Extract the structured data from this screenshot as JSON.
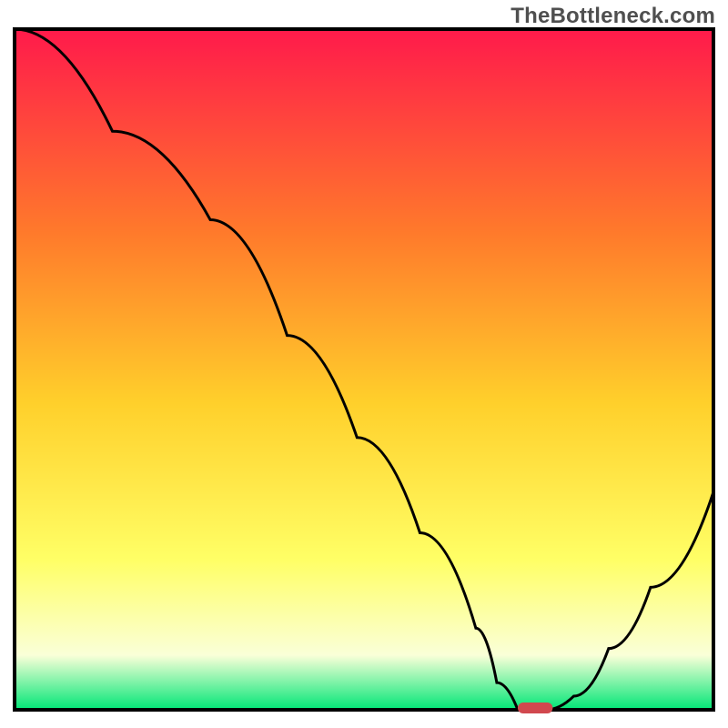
{
  "watermark": "TheBottleneck.com",
  "colors": {
    "border": "#000000",
    "curve": "#000000",
    "marker_fill": "#d1484e",
    "grad_top": "#ff1a4b",
    "grad_mid1": "#ff7a2b",
    "grad_mid2": "#ffd02b",
    "grad_mid3": "#ffff66",
    "grad_mid4": "#faffd8",
    "grad_bottom": "#00e676"
  },
  "chart_data": {
    "type": "line",
    "title": "",
    "xlabel": "",
    "ylabel": "",
    "xlim": [
      0,
      100
    ],
    "ylim": [
      0,
      100
    ],
    "x": [
      0,
      14,
      28,
      39,
      49,
      58,
      66,
      69,
      72,
      76,
      80,
      85,
      91,
      100
    ],
    "values": [
      100,
      85,
      72,
      55,
      40,
      26,
      12,
      4,
      0,
      0,
      2,
      9,
      18,
      32
    ],
    "optimum_marker": {
      "x_start": 72,
      "x_end": 77,
      "y": 0
    },
    "annotations": []
  }
}
